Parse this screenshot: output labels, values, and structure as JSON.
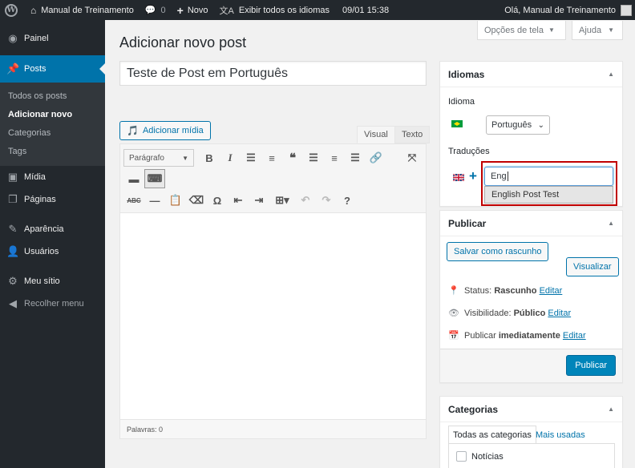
{
  "admin_bar": {
    "site_name": "Manual de Treinamento",
    "comments_count": "0",
    "new_label": "Novo",
    "languages_label": "Exibir todos os idiomas",
    "datetime": "09/01 15:38",
    "greeting": "Olá, Manual de Treinamento"
  },
  "sidebar": {
    "items": [
      {
        "label": "Painel",
        "icon": "dashboard-icon"
      },
      {
        "label": "Posts",
        "icon": "pin-icon"
      },
      {
        "label": "Mídia",
        "icon": "media-icon"
      },
      {
        "label": "Páginas",
        "icon": "pages-icon"
      },
      {
        "label": "Aparência",
        "icon": "brush-icon"
      },
      {
        "label": "Usuários",
        "icon": "users-icon"
      },
      {
        "label": "Meu sítio",
        "icon": "gear-icon"
      },
      {
        "label": "Recolher menu",
        "icon": "collapse-icon"
      }
    ],
    "submenu": [
      "Todos os posts",
      "Adicionar novo",
      "Categorias",
      "Tags"
    ]
  },
  "screen_options": {
    "screen_label": "Opções de tela",
    "help_label": "Ajuda"
  },
  "page": {
    "title": "Adicionar novo post"
  },
  "post": {
    "title_value": "Teste de Post em Português"
  },
  "editor": {
    "add_media_label": "Adicionar mídia",
    "tab_visual": "Visual",
    "tab_text": "Texto",
    "format_select": "Parágrafo",
    "word_count": "Palavras: 0"
  },
  "languages_box": {
    "title": "Idiomas",
    "language_label": "Idioma",
    "language_value": "Português",
    "translations_label": "Traduções",
    "translation_input": "Eng",
    "suggestion": "English Post Test",
    "highlight_color": "#c00000"
  },
  "publish_box": {
    "title": "Publicar",
    "save_draft": "Salvar como rascunho",
    "preview": "Visualizar",
    "status_label": "Status:",
    "status_value": "Rascunho",
    "visibility_label": "Visibilidade:",
    "visibility_value": "Público",
    "publish_label": "Publicar",
    "publish_value": "imediatamente",
    "edit_link": "Editar",
    "publish_button": "Publicar",
    "primary_color": "#0085ba"
  },
  "categories_box": {
    "title": "Categorias",
    "tab_all": "Todas as categorias",
    "tab_popular": "Mais usadas",
    "items": [
      "Notícias"
    ]
  }
}
